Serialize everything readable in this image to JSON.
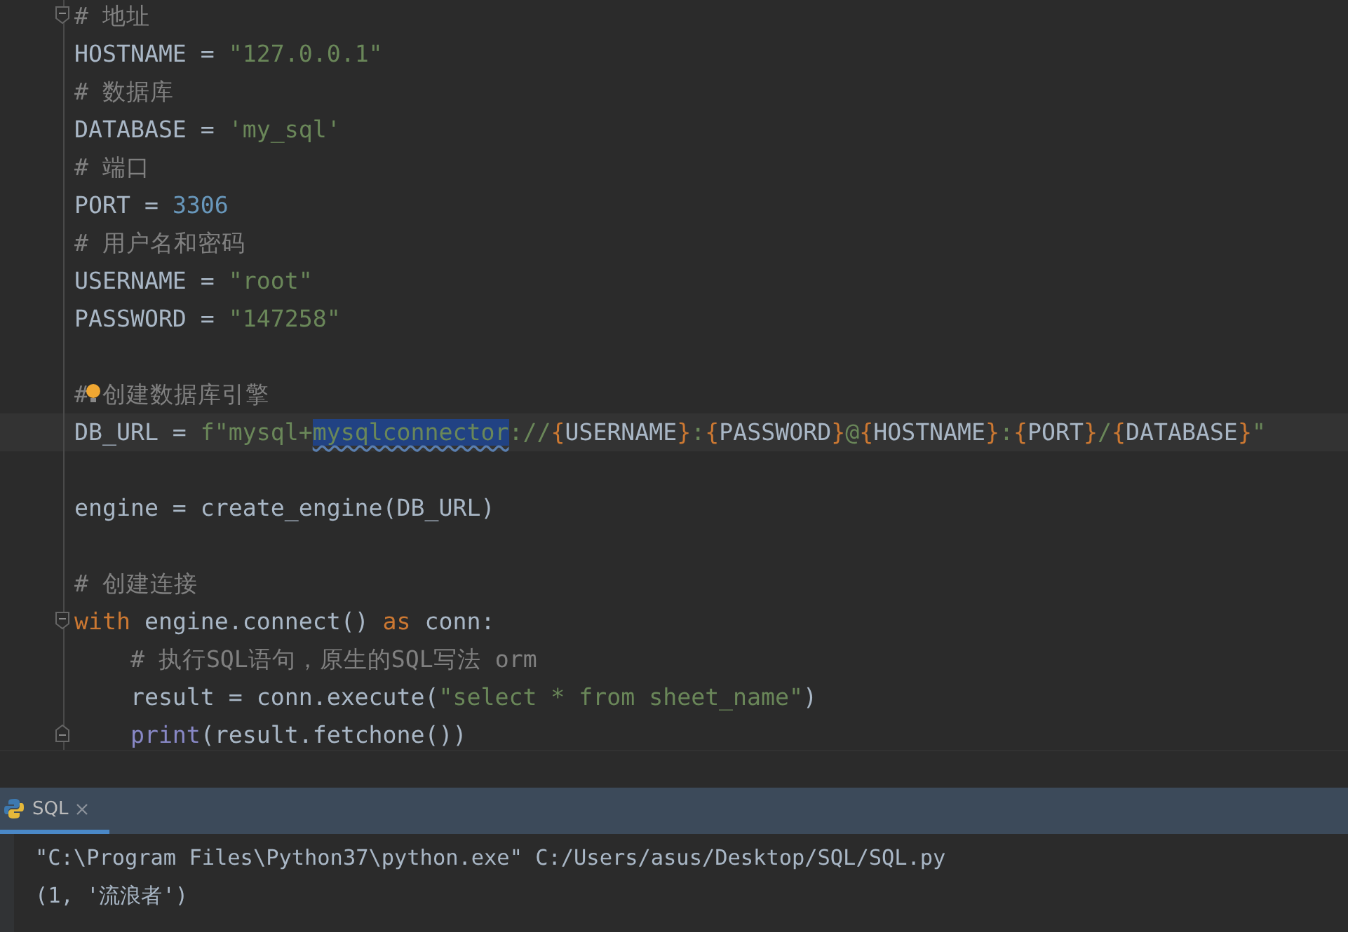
{
  "editor": {
    "lines": [
      {
        "kind": "code",
        "fold_start": true,
        "tokens": [
          {
            "text": "# 地址",
            "kind": "comment"
          }
        ]
      },
      {
        "kind": "code",
        "tokens": [
          {
            "text": "HOSTNAME = ",
            "kind": "plain"
          },
          {
            "text": "\"127.0.0.1\"",
            "kind": "string"
          }
        ]
      },
      {
        "kind": "code",
        "tokens": [
          {
            "text": "# 数据库",
            "kind": "comment"
          }
        ]
      },
      {
        "kind": "code",
        "tokens": [
          {
            "text": "DATABASE = ",
            "kind": "plain"
          },
          {
            "text": "'my_sql'",
            "kind": "string"
          }
        ]
      },
      {
        "kind": "code",
        "tokens": [
          {
            "text": "# 端口",
            "kind": "comment"
          }
        ]
      },
      {
        "kind": "code",
        "tokens": [
          {
            "text": "PORT = ",
            "kind": "plain"
          },
          {
            "text": "3306",
            "kind": "number"
          }
        ]
      },
      {
        "kind": "code",
        "tokens": [
          {
            "text": "# 用户名和密码",
            "kind": "comment"
          }
        ]
      },
      {
        "kind": "code",
        "tokens": [
          {
            "text": "USERNAME = ",
            "kind": "plain"
          },
          {
            "text": "\"root\"",
            "kind": "string"
          }
        ]
      },
      {
        "kind": "code",
        "tokens": [
          {
            "text": "PASSWORD = ",
            "kind": "plain"
          },
          {
            "text": "\"147258\"",
            "kind": "string"
          }
        ]
      },
      {
        "kind": "blank"
      },
      {
        "kind": "code",
        "bulb": true,
        "tokens": [
          {
            "text": "# 创建数据库引擎",
            "kind": "comment"
          }
        ]
      },
      {
        "kind": "code",
        "current": true,
        "tokens": [
          {
            "text": "DB_URL = ",
            "kind": "plain"
          },
          {
            "text": "f\"mysql+",
            "kind": "string"
          },
          {
            "text": "mysqlconnector",
            "kind": "selection"
          },
          {
            "text": "://",
            "kind": "string"
          },
          {
            "text": "{",
            "kind": "brace"
          },
          {
            "text": "USERNAME",
            "kind": "plain"
          },
          {
            "text": "}",
            "kind": "brace"
          },
          {
            "text": ":",
            "kind": "string"
          },
          {
            "text": "{",
            "kind": "brace"
          },
          {
            "text": "PASSWORD",
            "kind": "plain"
          },
          {
            "text": "}",
            "kind": "brace"
          },
          {
            "text": "@",
            "kind": "string"
          },
          {
            "text": "{",
            "kind": "brace"
          },
          {
            "text": "HOSTNAME",
            "kind": "plain"
          },
          {
            "text": "}",
            "kind": "brace"
          },
          {
            "text": ":",
            "kind": "string"
          },
          {
            "text": "{",
            "kind": "brace"
          },
          {
            "text": "PORT",
            "kind": "plain"
          },
          {
            "text": "}",
            "kind": "brace"
          },
          {
            "text": "/",
            "kind": "string"
          },
          {
            "text": "{",
            "kind": "brace"
          },
          {
            "text": "DATABASE",
            "kind": "plain"
          },
          {
            "text": "}",
            "kind": "brace"
          },
          {
            "text": "\"",
            "kind": "string"
          }
        ]
      },
      {
        "kind": "blank"
      },
      {
        "kind": "code",
        "tokens": [
          {
            "text": "engine = create_engine(DB_URL)",
            "kind": "plain"
          }
        ]
      },
      {
        "kind": "blank"
      },
      {
        "kind": "code",
        "tokens": [
          {
            "text": "# 创建连接",
            "kind": "comment"
          }
        ]
      },
      {
        "kind": "code",
        "fold_start": true,
        "tokens": [
          {
            "text": "with",
            "kind": "keyword"
          },
          {
            "text": " engine.connect() ",
            "kind": "plain"
          },
          {
            "text": "as",
            "kind": "keyword"
          },
          {
            "text": " conn:",
            "kind": "plain"
          }
        ]
      },
      {
        "kind": "code",
        "tokens": [
          {
            "text": "    # 执行SQL语句，原生的SQL写法 orm",
            "kind": "comment"
          }
        ]
      },
      {
        "kind": "code",
        "tokens": [
          {
            "text": "    result = conn.execute(",
            "kind": "plain"
          },
          {
            "text": "\"select * from sheet_name\"",
            "kind": "string"
          },
          {
            "text": ")",
            "kind": "plain"
          }
        ]
      },
      {
        "kind": "code",
        "fold_end": true,
        "tokens": [
          {
            "text": "    print",
            "kind": "builtin"
          },
          {
            "text": "(result.fetchone())",
            "kind": "plain"
          }
        ]
      }
    ]
  },
  "run_panel": {
    "tabs": [
      {
        "label": "SQL",
        "selected": true
      }
    ],
    "output": [
      "\"C:\\Program Files\\Python37\\python.exe\" C:/Users/asus/Desktop/SQL/SQL.py",
      "(1, '流浪者')"
    ]
  }
}
